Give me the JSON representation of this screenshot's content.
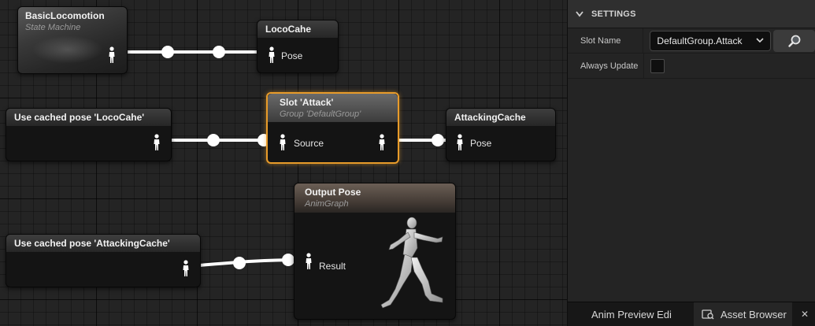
{
  "graph": {
    "nodes": {
      "basic_locomotion": {
        "title": "BasicLocomotion",
        "subtitle": "State Machine"
      },
      "loco_cahe": {
        "title": "LocoCahe",
        "pin": "Pose"
      },
      "slot_attack": {
        "title": "Slot 'Attack'",
        "subtitle": "Group 'DefaultGroup'",
        "pin": "Source"
      },
      "attacking_cache": {
        "title": "AttackingCache",
        "pin": "Pose"
      },
      "use_cached_loco": {
        "title": "Use cached pose 'LocoCahe'"
      },
      "use_cached_attacking": {
        "title": "Use cached pose 'AttackingCache'"
      },
      "output_pose": {
        "title": "Output Pose",
        "subtitle": "AnimGraph",
        "pin": "Result"
      }
    }
  },
  "details": {
    "section_title": "SETTINGS",
    "slot_name_label": "Slot Name",
    "slot_name_value": "DefaultGroup.Attack",
    "always_update_label": "Always Update",
    "always_update_checked": false
  },
  "bottom_tabs": {
    "anim_preview": "Anim Preview Edi",
    "asset_browser": "Asset Browser",
    "close": "✕"
  },
  "colors": {
    "selection_outline": "#e89b2a",
    "wire": "#ffffff",
    "canvas": "#242424"
  }
}
